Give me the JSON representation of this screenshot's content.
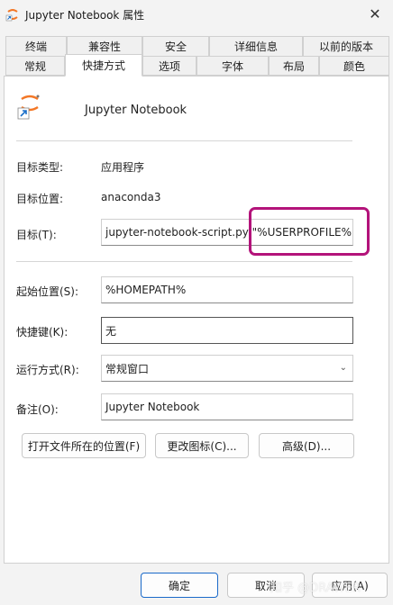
{
  "window": {
    "title": "Jupyter Notebook 属性",
    "close": "✕"
  },
  "tabs_row1": [
    "终端",
    "兼容性",
    "安全",
    "详细信息",
    "以前的版本"
  ],
  "tabs_row2": [
    "常规",
    "快捷方式",
    "选项",
    "字体",
    "布局",
    "颜色"
  ],
  "active_tab": "快捷方式",
  "shortcut": {
    "name": "Jupyter Notebook"
  },
  "info": {
    "target_type_label": "目标类型:",
    "target_type_value": "应用程序",
    "target_location_label": "目标位置:",
    "target_location_value": "anaconda3"
  },
  "fields": {
    "target_label": "目标(T):",
    "target_value": "jupyter-notebook-script.py \"%USERPROFILE%\"",
    "start_in_label": "起始位置(S):",
    "start_in_value": "%HOMEPATH%",
    "hotkey_label": "快捷键(K):",
    "hotkey_value": "无",
    "run_label": "运行方式(R):",
    "run_value": "常规窗口",
    "comment_label": "备注(O):",
    "comment_value": "Jupyter Notebook"
  },
  "buttons": {
    "open_location": "打开文件所在的位置(F)",
    "change_icon": "更改图标(C)...",
    "advanced": "高级(D)...",
    "ok": "确定",
    "cancel": "取消",
    "apply": "应用(A)"
  },
  "watermark": "知乎 @DRAWER",
  "colors": {
    "highlight": "#b3137a",
    "primary_border": "#1b6ac9"
  }
}
